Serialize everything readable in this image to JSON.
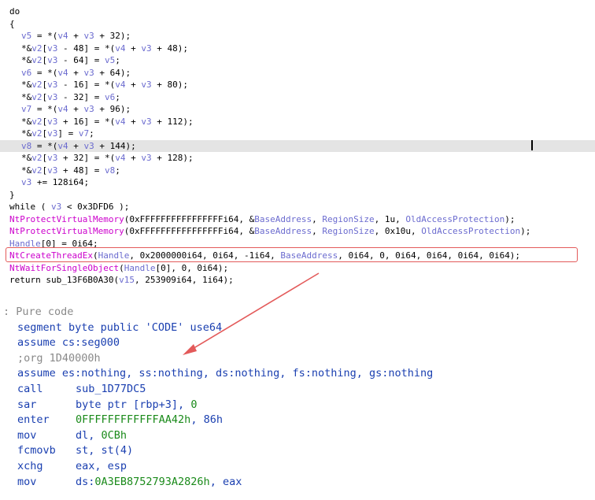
{
  "pseudocode": {
    "lines": [
      {
        "parts": [
          [
            "k",
            "do"
          ]
        ],
        "indent": 0
      },
      {
        "parts": [
          [
            "k",
            "{"
          ]
        ],
        "indent": 0
      },
      {
        "parts": [
          [
            "v",
            "v5"
          ],
          [
            "k",
            " = *("
          ],
          [
            "v",
            "v4"
          ],
          [
            "k",
            " + "
          ],
          [
            "v",
            "v3"
          ],
          [
            "k",
            " + 32);"
          ]
        ],
        "indent": 2
      },
      {
        "parts": [
          [
            "k",
            "*&"
          ],
          [
            "v",
            "v2"
          ],
          [
            "k",
            "["
          ],
          [
            "v",
            "v3"
          ],
          [
            "k",
            " - 48] = *("
          ],
          [
            "v",
            "v4"
          ],
          [
            "k",
            " + "
          ],
          [
            "v",
            "v3"
          ],
          [
            "k",
            " + 48);"
          ]
        ],
        "indent": 2
      },
      {
        "parts": [
          [
            "k",
            "*&"
          ],
          [
            "v",
            "v2"
          ],
          [
            "k",
            "["
          ],
          [
            "v",
            "v3"
          ],
          [
            "k",
            " - 64] = "
          ],
          [
            "v",
            "v5"
          ],
          [
            "k",
            ";"
          ]
        ],
        "indent": 2
      },
      {
        "parts": [
          [
            "v",
            "v6"
          ],
          [
            "k",
            " = *("
          ],
          [
            "v",
            "v4"
          ],
          [
            "k",
            " + "
          ],
          [
            "v",
            "v3"
          ],
          [
            "k",
            " + 64);"
          ]
        ],
        "indent": 2
      },
      {
        "parts": [
          [
            "k",
            "*&"
          ],
          [
            "v",
            "v2"
          ],
          [
            "k",
            "["
          ],
          [
            "v",
            "v3"
          ],
          [
            "k",
            " - 16] = *("
          ],
          [
            "v",
            "v4"
          ],
          [
            "k",
            " + "
          ],
          [
            "v",
            "v3"
          ],
          [
            "k",
            " + 80);"
          ]
        ],
        "indent": 2
      },
      {
        "parts": [
          [
            "k",
            "*&"
          ],
          [
            "v",
            "v2"
          ],
          [
            "k",
            "["
          ],
          [
            "v",
            "v3"
          ],
          [
            "k",
            " - 32] = "
          ],
          [
            "v",
            "v6"
          ],
          [
            "k",
            ";"
          ]
        ],
        "indent": 2
      },
      {
        "parts": [
          [
            "v",
            "v7"
          ],
          [
            "k",
            " = *("
          ],
          [
            "v",
            "v4"
          ],
          [
            "k",
            " + "
          ],
          [
            "v",
            "v3"
          ],
          [
            "k",
            " + 96);"
          ]
        ],
        "indent": 2
      },
      {
        "parts": [
          [
            "k",
            "*&"
          ],
          [
            "v",
            "v2"
          ],
          [
            "k",
            "["
          ],
          [
            "v",
            "v3"
          ],
          [
            "k",
            " + 16] = *("
          ],
          [
            "v",
            "v4"
          ],
          [
            "k",
            " + "
          ],
          [
            "v",
            "v3"
          ],
          [
            "k",
            " + 112);"
          ]
        ],
        "indent": 2
      },
      {
        "parts": [
          [
            "k",
            "*&"
          ],
          [
            "v",
            "v2"
          ],
          [
            "k",
            "["
          ],
          [
            "v",
            "v3"
          ],
          [
            "k",
            "] = "
          ],
          [
            "v",
            "v7"
          ],
          [
            "k",
            ";"
          ]
        ],
        "indent": 2
      },
      {
        "parts": [
          [
            "v",
            "v8"
          ],
          [
            "k",
            " = *("
          ],
          [
            "v",
            "v4"
          ],
          [
            "k",
            " + "
          ],
          [
            "v",
            "v3"
          ],
          [
            "k",
            " + 144);"
          ]
        ],
        "indent": 2,
        "highlight": true
      },
      {
        "parts": [
          [
            "k",
            "*&"
          ],
          [
            "v",
            "v2"
          ],
          [
            "k",
            "["
          ],
          [
            "v",
            "v3"
          ],
          [
            "k",
            " + 32] = *("
          ],
          [
            "v",
            "v4"
          ],
          [
            "k",
            " + "
          ],
          [
            "v",
            "v3"
          ],
          [
            "k",
            " + 128);"
          ]
        ],
        "indent": 2
      },
      {
        "parts": [
          [
            "k",
            "*&"
          ],
          [
            "v",
            "v2"
          ],
          [
            "k",
            "["
          ],
          [
            "v",
            "v3"
          ],
          [
            "k",
            " + 48] = "
          ],
          [
            "v",
            "v8"
          ],
          [
            "k",
            ";"
          ]
        ],
        "indent": 2
      },
      {
        "parts": [
          [
            "v",
            "v3"
          ],
          [
            "k",
            " += 128i64;"
          ]
        ],
        "indent": 2
      },
      {
        "parts": [
          [
            "k",
            "}"
          ]
        ],
        "indent": 0
      },
      {
        "parts": [
          [
            "k",
            "while ( "
          ],
          [
            "v",
            "v3"
          ],
          [
            "k",
            " < 0x3DFD6 );"
          ]
        ],
        "indent": 0
      },
      {
        "parts": [
          [
            "f",
            "NtProtectVirtualMemory"
          ],
          [
            "k",
            "(0xFFFFFFFFFFFFFFFFi64, &"
          ],
          [
            "v",
            "BaseAddress"
          ],
          [
            "k",
            ", "
          ],
          [
            "v",
            "RegionSize"
          ],
          [
            "k",
            ", 1u, "
          ],
          [
            "v",
            "OldAccessProtection"
          ],
          [
            "k",
            ");"
          ]
        ],
        "indent": 0
      },
      {
        "parts": [
          [
            "f",
            "NtProtectVirtualMemory"
          ],
          [
            "k",
            "(0xFFFFFFFFFFFFFFFFi64, &"
          ],
          [
            "v",
            "BaseAddress"
          ],
          [
            "k",
            ", "
          ],
          [
            "v",
            "RegionSize"
          ],
          [
            "k",
            ", 0x10u, "
          ],
          [
            "v",
            "OldAccessProtection"
          ],
          [
            "k",
            ");"
          ]
        ],
        "indent": 0
      },
      {
        "parts": [
          [
            "v",
            "Handle"
          ],
          [
            "k",
            "[0] = 0i64;"
          ]
        ],
        "indent": 0
      },
      {
        "parts": [
          [
            "f",
            "NtCreateThreadEx"
          ],
          [
            "k",
            "("
          ],
          [
            "v",
            "Handle"
          ],
          [
            "k",
            ", 0x2000000i64, 0i64, -1i64, "
          ],
          [
            "v",
            "BaseAddress"
          ],
          [
            "k",
            ", 0i64, 0, 0i64, 0i64, 0i64, 0i64);"
          ]
        ],
        "indent": 0
      },
      {
        "parts": [
          [
            "f",
            "NtWaitForSingleObject"
          ],
          [
            "k",
            "("
          ],
          [
            "v",
            "Handle"
          ],
          [
            "k",
            "[0], 0, 0i64);"
          ]
        ],
        "indent": 0
      },
      {
        "parts": [
          [
            "k",
            "return sub_13F6B0A30("
          ],
          [
            "v",
            "v15"
          ],
          [
            "k",
            ", 253909i64, 1i64);"
          ]
        ],
        "indent": 0
      }
    ]
  },
  "disassembly": {
    "lines": [
      {
        "parts": [
          [
            "cmt",
            ": Pure code"
          ]
        ],
        "x": 0
      },
      {
        "parts": [
          [
            "plain",
            "segment byte public "
          ],
          [
            "str",
            "'CODE'"
          ],
          [
            "plain",
            " use64"
          ]
        ],
        "x": 1
      },
      {
        "parts": [
          [
            "plain",
            "assume cs:seg000"
          ]
        ],
        "x": 1
      },
      {
        "parts": [
          [
            "cmt",
            ";org 1D40000h"
          ]
        ],
        "x": 1
      },
      {
        "parts": [
          [
            "plain",
            "assume es:nothing, ss:nothing, ds:nothing, fs:nothing, gs:nothing"
          ]
        ],
        "x": 1
      },
      {
        "mn": "call",
        "parts": [
          [
            "op",
            "sub_1D77DC5"
          ]
        ],
        "x": 1
      },
      {
        "mn": "sar",
        "parts": [
          [
            "op",
            "byte ptr [rbp+3], "
          ],
          [
            "num",
            "0"
          ]
        ],
        "x": 1
      },
      {
        "mn": "enter",
        "parts": [
          [
            "num",
            "0FFFFFFFFFFFFAA42h"
          ],
          [
            "op",
            ", 86h"
          ]
        ],
        "x": 1
      },
      {
        "mn": "mov",
        "parts": [
          [
            "op",
            "dl, "
          ],
          [
            "num",
            "0CBh"
          ]
        ],
        "x": 1
      },
      {
        "mn": "fcmovb",
        "parts": [
          [
            "op",
            "st, st(4)"
          ]
        ],
        "x": 1
      },
      {
        "mn": "xchg",
        "parts": [
          [
            "op",
            "eax, esp"
          ]
        ],
        "x": 1
      },
      {
        "mn": "mov",
        "parts": [
          [
            "op",
            "ds:"
          ],
          [
            "num",
            "0A3EB8752793A2826h"
          ],
          [
            "op",
            ", eax"
          ]
        ],
        "x": 1
      }
    ]
  },
  "colors": {
    "annotation": "#e35a5a",
    "highlight": "#e4e4e4"
  }
}
